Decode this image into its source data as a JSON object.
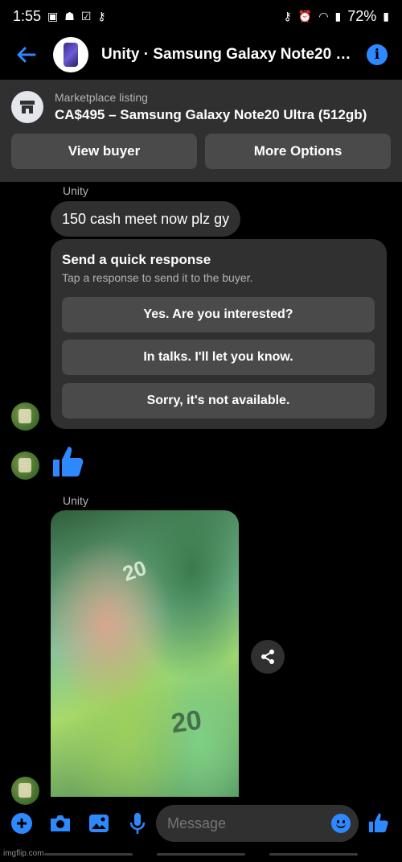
{
  "status_bar": {
    "time": "1:55",
    "battery": "72%"
  },
  "header": {
    "title": "Unity · Samsung Galaxy Note20 Ul..."
  },
  "listing": {
    "label": "Marketplace listing",
    "title": "CA$495 – Samsung Galaxy Note20 Ultra (512gb)",
    "view_buyer": "View buyer",
    "more_options": "More Options"
  },
  "messages": {
    "sender_1": "Unity",
    "text_1": "150 cash meet now plz gy",
    "sender_2": "Unity"
  },
  "quick_response": {
    "title": "Send a quick response",
    "subtitle": "Tap a response to send it to the buyer.",
    "options": [
      "Yes. Are you interested?",
      "In talks. I'll let you know.",
      "Sorry, it's not available."
    ]
  },
  "photo": {
    "note_value_1": "20",
    "note_value_2": "20"
  },
  "composer": {
    "placeholder": "Message"
  },
  "watermark": "imgflip.com",
  "colors": {
    "accent": "#2e89ff",
    "bubble": "#303030",
    "button": "#4a4a4a",
    "background": "#000000"
  }
}
